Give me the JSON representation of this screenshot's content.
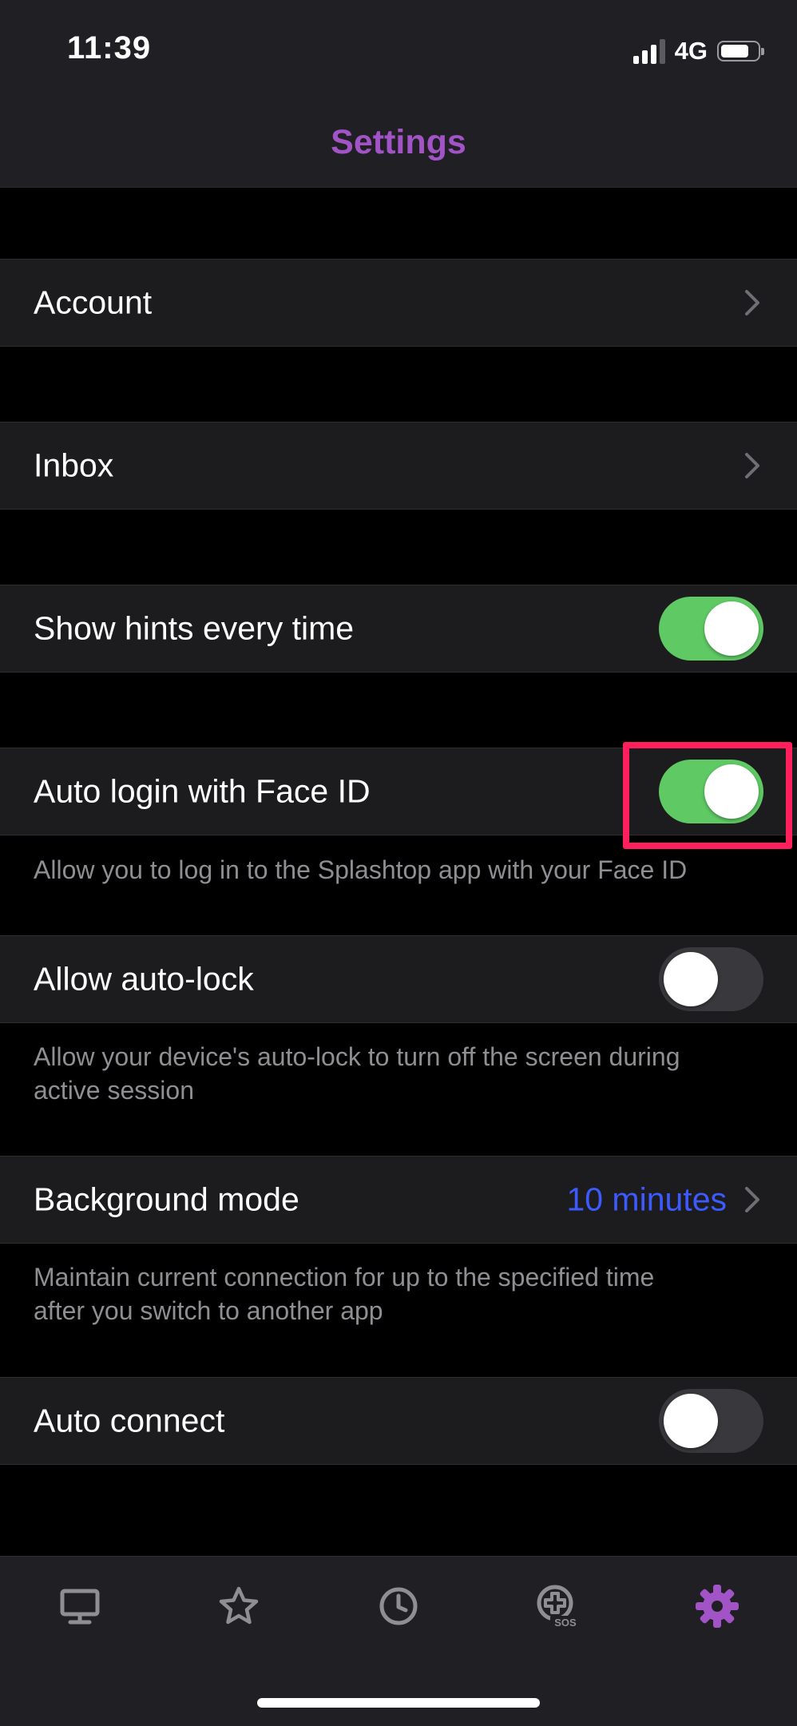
{
  "status_bar": {
    "time": "11:39",
    "network": "4G",
    "signal_bars": 3,
    "signal_bars_max": 4
  },
  "nav": {
    "title": "Settings"
  },
  "settings": {
    "account": {
      "label": "Account"
    },
    "inbox": {
      "label": "Inbox"
    },
    "show_hints": {
      "label": "Show hints every time",
      "enabled": true
    },
    "auto_login": {
      "label": "Auto login with Face ID",
      "enabled": true,
      "description": "Allow you to log in to the Splashtop app with your Face ID"
    },
    "auto_lock": {
      "label": "Allow auto-lock",
      "enabled": false,
      "description_line1": "Allow your device's auto-lock to turn off the screen during",
      "description_line2": "active session"
    },
    "background_mode": {
      "label": "Background mode",
      "value": "10 minutes",
      "description_line1": "Maintain current connection for up to the specified time",
      "description_line2": "after you switch to another app"
    },
    "auto_connect": {
      "label": "Auto connect",
      "enabled": false
    }
  },
  "tab_bar": {
    "tabs": [
      {
        "icon": "computer-icon",
        "selected": false
      },
      {
        "icon": "star-icon",
        "selected": false
      },
      {
        "icon": "clock-icon",
        "selected": false
      },
      {
        "icon": "sos-icon",
        "selected": false,
        "badge": "SOS"
      },
      {
        "icon": "gear-icon",
        "selected": true
      }
    ]
  },
  "colors": {
    "accent": "#a254c7",
    "toggle_on": "#5fc964",
    "toggle_off": "#39393d",
    "link_value": "#3d5afe",
    "highlight": "#ff1f5c",
    "tab_inactive": "#8e8e93"
  }
}
